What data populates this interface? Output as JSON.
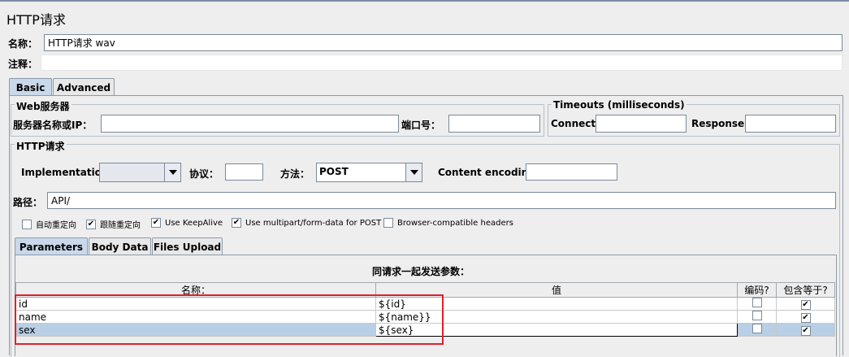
{
  "title": "HTTP请求",
  "name_label": "名称：",
  "name_value": "HTTP请求 wav",
  "comment_label": "注释：",
  "comment_value": "",
  "tabs": [
    "Basic",
    "Advanced"
  ],
  "web_server": {
    "title": "Web服务器",
    "server_label": "服务器名称或IP：",
    "server_value": "",
    "port_label": "端口号：",
    "port_value": ""
  },
  "timeouts": {
    "title": "Timeouts (milliseconds)",
    "connect_label": "Connect:",
    "connect_value": "",
    "response_label": "Response:",
    "response_value": ""
  },
  "http_request": {
    "title": "HTTP请求",
    "implementation_label": "Implementation:",
    "implementation_value": "",
    "protocol_label": "协议：",
    "protocol_value": "",
    "method_label": "方法：",
    "method_value": "POST",
    "encoding_label": "Content encoding:",
    "encoding_value": "",
    "path_label": "路径：",
    "path_value": "API/"
  },
  "options": [
    {
      "label": "自动重定向",
      "checked": false
    },
    {
      "label": "跟随重定向",
      "checked": true
    },
    {
      "label": "Use KeepAlive",
      "checked": true
    },
    {
      "label": "Use multipart/form-data for POST",
      "checked": true
    },
    {
      "label": "Browser-compatible headers",
      "checked": false
    }
  ],
  "sub_tabs": [
    "Parameters",
    "Body Data",
    "Files Upload"
  ],
  "params_caption": "同请求一起发送参数：",
  "params_table": {
    "headers": [
      "名称：",
      "值",
      "编码?",
      "包含等于?"
    ],
    "rows": [
      {
        "name": "id",
        "value": "${id}",
        "encode": false,
        "include_equals": true
      },
      {
        "name": "name",
        "value": "${name}}",
        "encode": false,
        "include_equals": true
      },
      {
        "name": "sex",
        "value": "${sex}",
        "encode": false,
        "include_equals": true
      }
    ]
  },
  "check_glyph": "✔"
}
